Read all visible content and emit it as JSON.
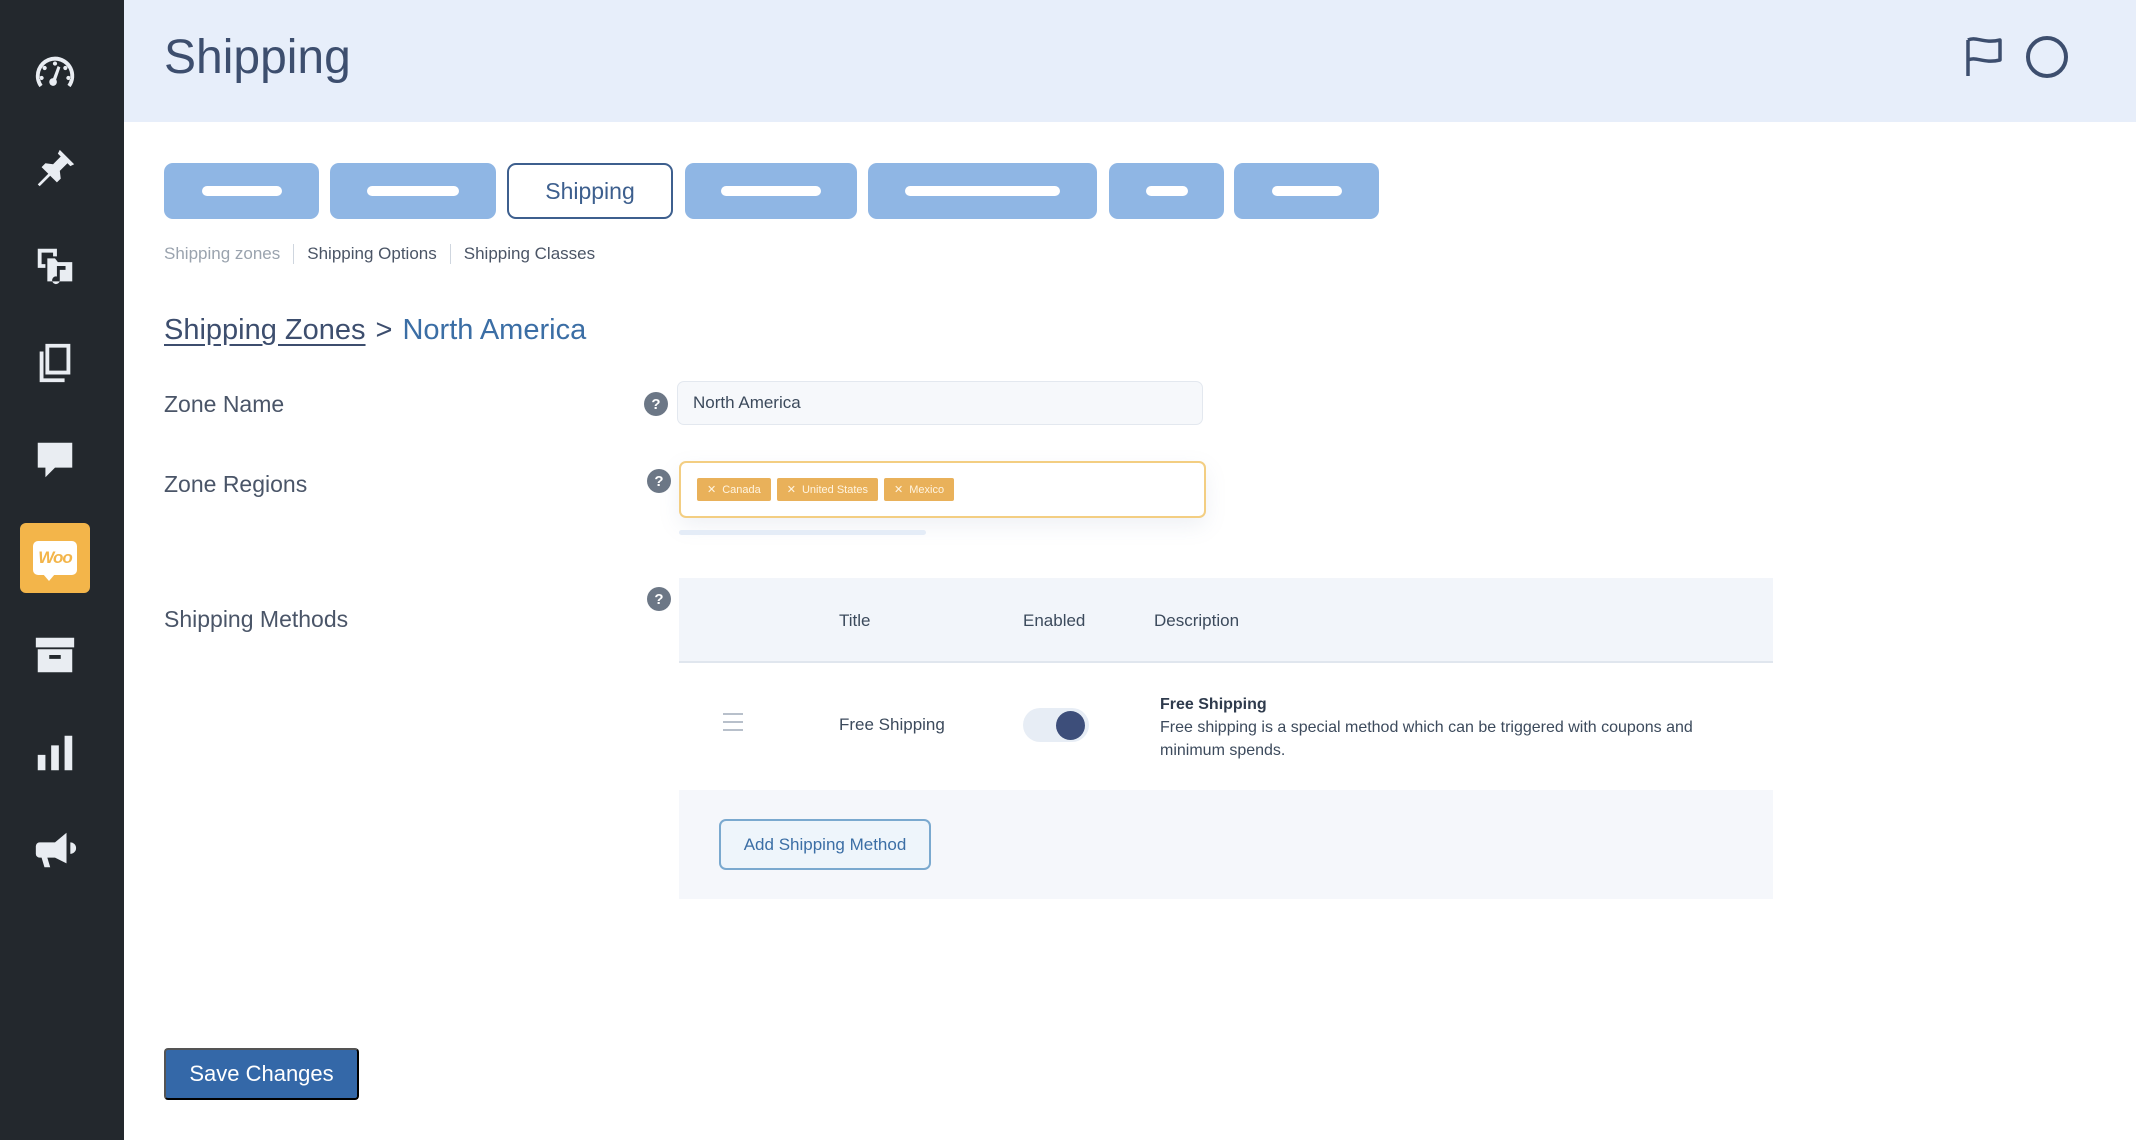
{
  "header": {
    "title": "Shipping"
  },
  "sidebar": {
    "items": [
      {
        "icon": "dashboard-icon"
      },
      {
        "icon": "pin-icon"
      },
      {
        "icon": "media-icon"
      },
      {
        "icon": "pages-icon"
      },
      {
        "icon": "comments-icon"
      },
      {
        "icon": "woocommerce-icon",
        "label": "Woo",
        "active": true
      },
      {
        "icon": "archive-icon"
      },
      {
        "icon": "analytics-icon"
      },
      {
        "icon": "marketing-icon"
      }
    ]
  },
  "tabs": {
    "active_label": "Shipping"
  },
  "subnav": {
    "items": [
      "Shipping zones",
      "Shipping Options",
      "Shipping Classes"
    ]
  },
  "breadcrumb": {
    "parent": "Shipping Zones",
    "separator": ">",
    "current": "North America"
  },
  "form": {
    "zone_name_label": "Zone Name",
    "zone_name_value": "North America",
    "zone_regions_label": "Zone Regions",
    "regions": [
      "Canada",
      "United States",
      "Mexico"
    ],
    "shipping_methods_label": "Shipping Methods",
    "help_glyph": "?"
  },
  "methods_table": {
    "columns": [
      "Title",
      "Enabled",
      "Description"
    ],
    "rows": [
      {
        "title": "Free Shipping",
        "enabled": true,
        "description_title": "Free Shipping",
        "description": "Free shipping is a special method which can be triggered with coupons and minimum spends."
      }
    ],
    "add_button": "Add Shipping Method"
  },
  "save_button": "Save Changes",
  "colors": {
    "sidebar": "#23282d",
    "accent": "#f3b54a",
    "primary": "#3468a8",
    "header_bg": "#e7eefa"
  }
}
